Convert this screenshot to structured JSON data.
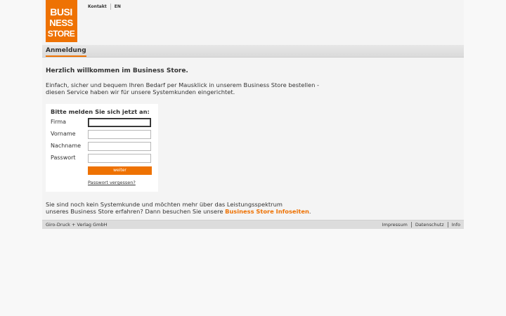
{
  "brand": {
    "logo_line1": "BUSI",
    "logo_line2": "NESS",
    "logo_line3": "STORE",
    "accent_color": "#ee7203"
  },
  "topnav": {
    "items": [
      "Kontakt",
      "EN"
    ]
  },
  "tabs": {
    "active_label": "Anmeldung"
  },
  "main": {
    "welcome": "Herzlich willkommen im Business Store.",
    "intro_line1": "Einfach, sicher und bequem Ihren Bedarf per Mausklick in unserem Business Store bestellen -",
    "intro_line2": "diesen Service haben wir für unsere Systemkunden eingerichtet."
  },
  "login": {
    "heading": "Bitte melden Sie sich jetzt an:",
    "fields": [
      {
        "label": "Firma",
        "value": "",
        "placeholder": ""
      },
      {
        "label": "Vorname",
        "value": "",
        "placeholder": ""
      },
      {
        "label": "Nachname",
        "value": "",
        "placeholder": ""
      },
      {
        "label": "Passwort",
        "value": "",
        "placeholder": ""
      }
    ],
    "submit_label": "weiter",
    "forgot_label": "Passwort vergessen?"
  },
  "info": {
    "line1": "Sie sind noch kein Systemkunde und möchten mehr über das Leistungsspektrum",
    "line2_prefix": "unseres Business Store erfahren? Dann besuchen Sie unsere ",
    "link": "Business Store Infoseiten",
    "line2_suffix": "."
  },
  "footer": {
    "company": "Giro-Druck + Verlag GmbH",
    "links": [
      "Impressum",
      "Datenschutz",
      "Info"
    ]
  }
}
